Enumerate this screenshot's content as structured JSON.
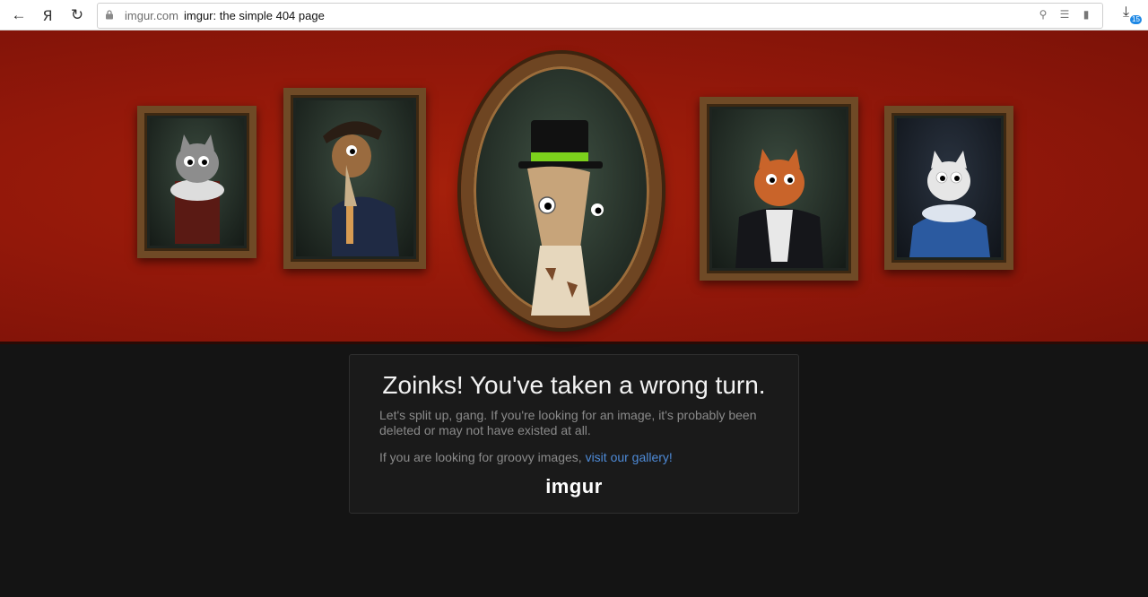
{
  "browser": {
    "domain": "imgur.com",
    "tab_title": "imgur: the simple 404 page",
    "yandex_label": "Я",
    "download_count": "15"
  },
  "banner": {
    "colors": {
      "wall": "#93180a",
      "frame": "#6f4a26"
    },
    "portraits": [
      {
        "subject": "gray cat in ruff collar"
      },
      {
        "subject": "ferret in bicorne hat"
      },
      {
        "subject": "giraffe in top hat with monocle"
      },
      {
        "subject": "orange cat with jabot"
      },
      {
        "subject": "white cat in blue dress"
      }
    ]
  },
  "card": {
    "headline": "Zoinks! You've taken a wrong turn.",
    "paragraph1": "Let's split up, gang. If you're looking for an image, it's probably been deleted or may not have existed at all.",
    "paragraph2_prefix": "If you are looking for groovy images,",
    "gallery_link": "visit our gallery!",
    "logo_text": "imgur"
  }
}
